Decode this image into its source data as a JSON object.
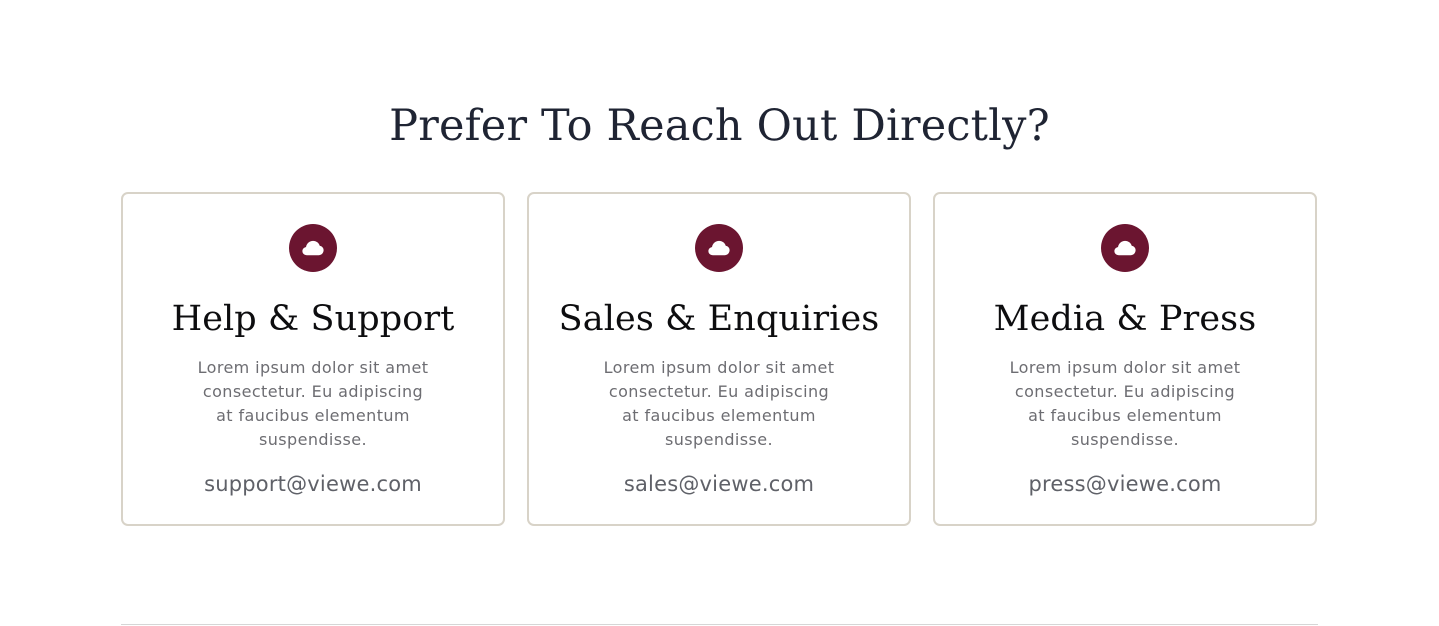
{
  "section": {
    "heading": "Prefer To Reach Out Directly?"
  },
  "colors": {
    "accent": "#6b1530",
    "card_border": "#d8d3c8",
    "heading": "#1f2433",
    "body_text": "#6d6d72"
  },
  "cards": [
    {
      "icon": "cloud-icon",
      "title": "Help & Support",
      "text": "Lorem ipsum dolor sit amet consectetur. Eu adipiscing at faucibus elementum suspendisse.",
      "email": "support@viewe.com"
    },
    {
      "icon": "cloud-icon",
      "title": "Sales & Enquiries",
      "text": "Lorem ipsum dolor sit amet consectetur. Eu adipiscing at faucibus elementum suspendisse.",
      "email": "sales@viewe.com"
    },
    {
      "icon": "cloud-icon",
      "title": "Media & Press",
      "text": "Lorem ipsum dolor sit amet consectetur. Eu adipiscing at faucibus elementum suspendisse.",
      "email": "press@viewe.com"
    }
  ]
}
